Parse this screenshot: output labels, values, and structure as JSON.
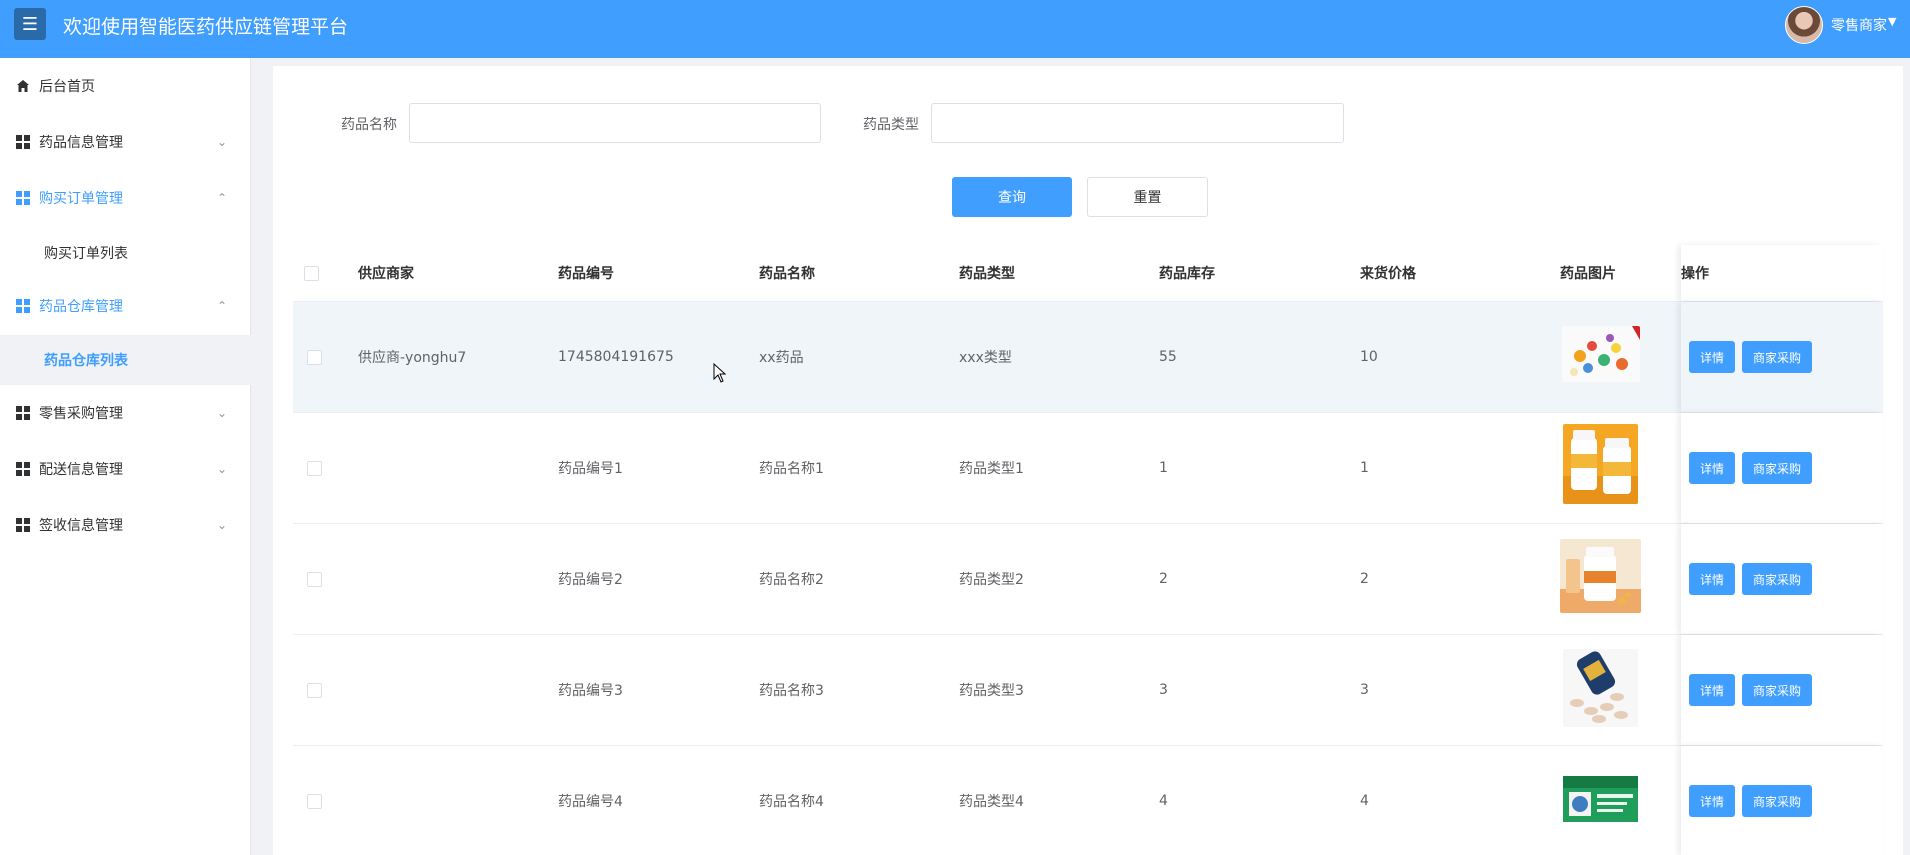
{
  "header": {
    "title": "欢迎使用智能医药供应链管理平台",
    "user_name": "零售商家"
  },
  "sidebar": {
    "items": [
      {
        "label": "后台首页"
      },
      {
        "label": "药品信息管理"
      },
      {
        "label": "购买订单管理"
      },
      {
        "label": "购买订单列表"
      },
      {
        "label": "药品仓库管理"
      },
      {
        "label": "药品仓库列表"
      },
      {
        "label": "零售采购管理"
      },
      {
        "label": "配送信息管理"
      },
      {
        "label": "签收信息管理"
      }
    ]
  },
  "filters": {
    "name_label": "药品名称",
    "name_value": "",
    "type_label": "药品类型",
    "type_value": "",
    "query_label": "查询",
    "reset_label": "重置"
  },
  "table": {
    "headers": [
      "供应商家",
      "药品编号",
      "药品名称",
      "药品类型",
      "药品库存",
      "来货价格",
      "药品图片",
      "操作"
    ],
    "rows": [
      {
        "supplier": "供应商-yonghu7",
        "code": "1745804191675",
        "name": "xx药品",
        "type": "xxx类型",
        "stock": "55",
        "price": "10"
      },
      {
        "supplier": "",
        "code": "药品编号1",
        "name": "药品名称1",
        "type": "药品类型1",
        "stock": "1",
        "price": "1"
      },
      {
        "supplier": "",
        "code": "药品编号2",
        "name": "药品名称2",
        "type": "药品类型2",
        "stock": "2",
        "price": "2"
      },
      {
        "supplier": "",
        "code": "药品编号3",
        "name": "药品名称3",
        "type": "药品类型3",
        "stock": "3",
        "price": "3"
      },
      {
        "supplier": "",
        "code": "药品编号4",
        "name": "药品名称4",
        "type": "药品类型4",
        "stock": "4",
        "price": "4"
      }
    ],
    "detail_label": "详情",
    "buy_label": "商家采购"
  },
  "colors": {
    "primary": "#409eff",
    "menu_button": "#2b6aa8",
    "row_hover": "#f0f5fa"
  }
}
